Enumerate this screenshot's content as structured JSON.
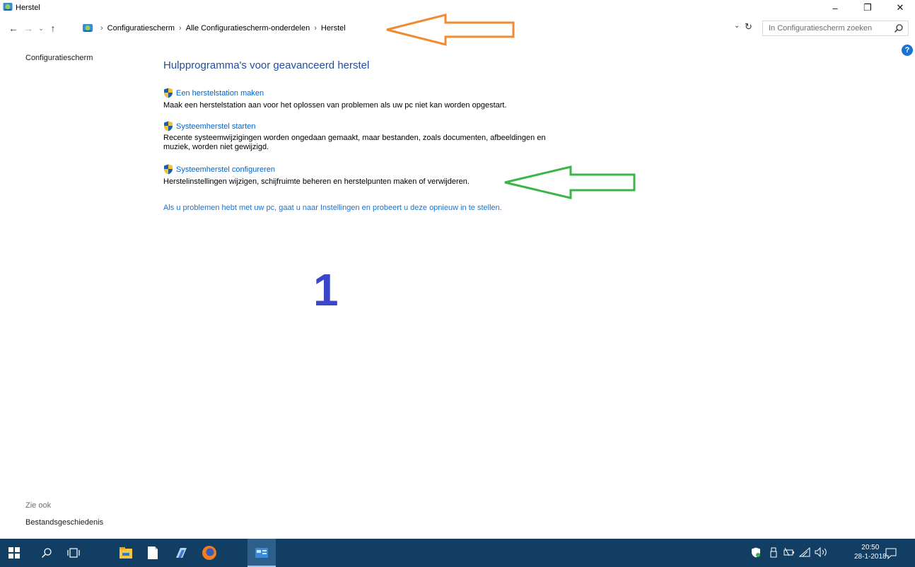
{
  "window": {
    "title": "Herstel",
    "minimize_glyph": "–",
    "maximize_glyph": "❐",
    "close_glyph": "✕"
  },
  "navbar": {
    "back_glyph": "←",
    "forward_glyph": "→",
    "recent_glyph": "⌄",
    "up_glyph": "↑",
    "breadcrumbs": [
      "Configuratiescherm",
      "Alle Configuratiescherm-onderdelen",
      "Herstel"
    ],
    "separator": "›",
    "dropdown_glyph": "⌄",
    "refresh_glyph": "↻",
    "search_placeholder": "In Configuratiescherm zoeken"
  },
  "help": {
    "glyph": "?"
  },
  "left_nav": {
    "home_link": "Configuratiescherm",
    "see_also_heading": "Zie ook",
    "see_also_links": [
      "Bestandsgeschiedenis"
    ]
  },
  "main": {
    "title": "Hulpprogramma's voor geavanceerd herstel",
    "tasks": [
      {
        "link": "Een herstelstation maken",
        "desc": "Maak een herstelstation aan voor het oplossen van problemen als uw pc niet kan worden opgestart."
      },
      {
        "link": "Systeemherstel starten",
        "desc": "Recente systeemwijzigingen worden ongedaan gemaakt, maar bestanden, zoals documenten, afbeeldingen en muziek, worden niet gewijzigd."
      },
      {
        "link": "Systeemherstel configureren",
        "desc": "Herstelinstellingen wijzigen, schijfruimte beheren en herstelpunten maken of verwijderen."
      }
    ],
    "bottom_link": "Als u problemen hebt met uw pc, gaat u naar Instellingen en probeert u deze opnieuw in te stellen."
  },
  "annotations": {
    "number": "1",
    "orange_arrow_color": "#f28a30",
    "green_arrow_color": "#3bb54a",
    "number_color": "#3b47c9"
  },
  "taskbar": {
    "background": "#123e63",
    "items": [
      "start-icon",
      "search-icon",
      "task-view-icon",
      "file-explorer-icon",
      "document-icon",
      "app-icon",
      "firefox-icon",
      "control-panel-icon"
    ],
    "clock_time": "20:50",
    "clock_date": "28-1-2018"
  }
}
